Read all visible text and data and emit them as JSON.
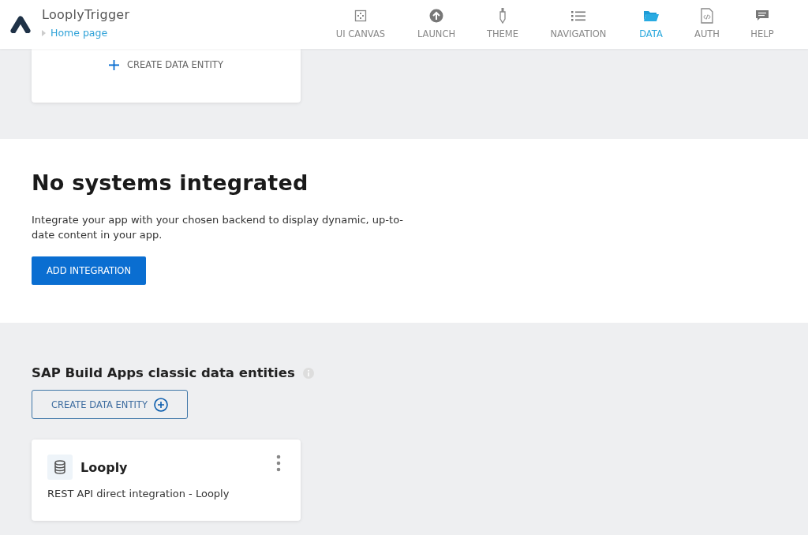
{
  "header": {
    "app_name": "LooplyTrigger",
    "breadcrumb": "Home page"
  },
  "nav": [
    {
      "label": "UI CANVAS",
      "kind": "canvas",
      "selected": false
    },
    {
      "label": "LAUNCH",
      "kind": "launch",
      "selected": false
    },
    {
      "label": "THEME",
      "kind": "theme",
      "selected": false
    },
    {
      "label": "NAVIGATION",
      "kind": "list",
      "selected": false
    },
    {
      "label": "DATA",
      "kind": "folder",
      "selected": true
    },
    {
      "label": "AUTH",
      "kind": "file",
      "selected": false
    },
    {
      "label": "HELP",
      "kind": "chat",
      "selected": false
    }
  ],
  "top_card": {
    "button": "CREATE DATA ENTITY"
  },
  "integration": {
    "title": "No systems integrated",
    "description": "Integrate your app with your chosen backend to display dynamic, up-to-date content in your app.",
    "button": "ADD INTEGRATION"
  },
  "classic": {
    "title": "SAP Build Apps classic data entities",
    "button": "CREATE DATA ENTITY",
    "entities": [
      {
        "name": "Looply",
        "description": "REST API direct integration - Looply"
      }
    ]
  }
}
